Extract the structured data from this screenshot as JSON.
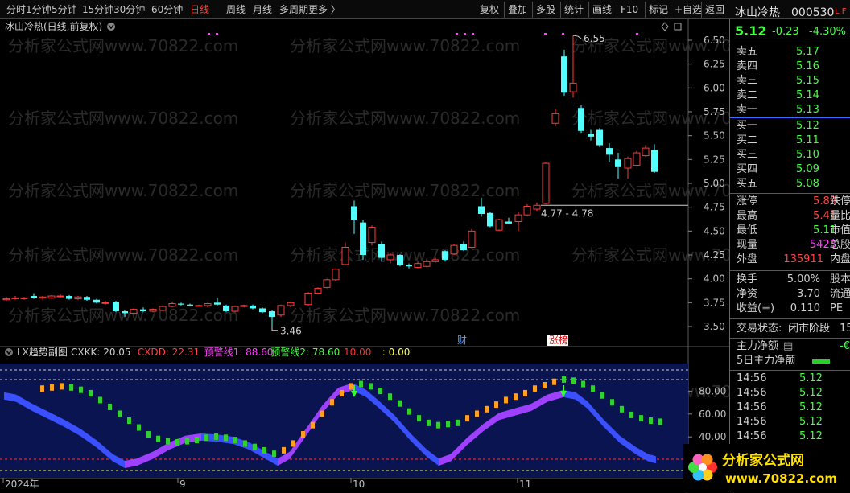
{
  "toolbar": {
    "left_items": [
      "分时",
      "1分钟",
      "5分钟",
      "15分钟",
      "30分钟",
      "60分钟",
      "日线",
      "周线",
      "月线",
      "多周期",
      "更多 〉"
    ],
    "active_item": "日线",
    "right_items": [
      "复权",
      "叠加",
      "多股",
      "统计",
      "画线",
      "F10",
      "标记",
      "+自选",
      "返回"
    ]
  },
  "main_chart": {
    "title": "冰山冷热(日线,前复权)",
    "y_ticks": [
      "6.50",
      "6.25",
      "6.00",
      "5.75",
      "5.50",
      "5.25",
      "5.00",
      "4.75",
      "4.50",
      "4.25",
      "4.00",
      "3.75",
      "3.50"
    ],
    "high_label": "6.55",
    "low_label": "3.46",
    "range_label": "4.77 - 4.78",
    "event_tags": [
      "财",
      "涨榜"
    ],
    "watermark": "分析家公式网www.70822.com"
  },
  "indicator": {
    "name": "LX趋势副图",
    "params": [
      {
        "text": "CXKK: 20.05",
        "color": "#d0d0d0"
      },
      {
        "text": "CXDD: 22.31",
        "color": "#ff4444"
      },
      {
        "text": "预警线1: 88.60",
        "color": "#ff44ff"
      },
      {
        "text": "预警线2: 78.60",
        "color": "#44ff44"
      },
      {
        "text": ": 10.00",
        "color": "#ff3333"
      },
      {
        "text": ": 0.00",
        "color": "#ffff44"
      }
    ],
    "y_ticks": [
      "80.00",
      "60.00",
      "40.00"
    ]
  },
  "x_axis": [
    "2024年",
    "9",
    "10",
    "11"
  ],
  "stock": {
    "name": "冰山冷热",
    "code": "000530",
    "flag": "L F",
    "price": "5.12",
    "change": "-0.23",
    "change_pct": "-4.30%"
  },
  "sell_levels": [
    {
      "label": "卖五",
      "price": "5.17"
    },
    {
      "label": "卖四",
      "price": "5.16"
    },
    {
      "label": "卖三",
      "price": "5.15"
    },
    {
      "label": "卖二",
      "price": "5.14"
    },
    {
      "label": "卖一",
      "price": "5.13"
    }
  ],
  "buy_levels": [
    {
      "label": "买一",
      "price": "5.12"
    },
    {
      "label": "买二",
      "price": "5.11"
    },
    {
      "label": "买三",
      "price": "5.10"
    },
    {
      "label": "买四",
      "price": "5.09"
    },
    {
      "label": "买五",
      "price": "5.08"
    }
  ],
  "quote_stats": [
    {
      "label": "涨停",
      "value": "5.89",
      "color": "#ff4444",
      "extra": "跌停"
    },
    {
      "label": "最高",
      "value": "5.41",
      "color": "#ff4444",
      "extra": "量比"
    },
    {
      "label": "最低",
      "value": "5.11",
      "color": "#44ff44",
      "extra": "市值"
    },
    {
      "label": "现量",
      "value": "5423",
      "color": "#ff44ff",
      "extra": "总股"
    },
    {
      "label": "外盘",
      "value": "135911",
      "color": "#ff4444",
      "extra": "内盘"
    }
  ],
  "fundamentals": [
    {
      "label": "换手",
      "value": "5.00%",
      "extra": "股本"
    },
    {
      "label": "净资",
      "value": "3.70",
      "extra": "流通"
    },
    {
      "label": "收益(≡)",
      "value": "0.110",
      "extra": "PE"
    }
  ],
  "trade_status": {
    "label": "交易状态:",
    "value": "闭市阶段",
    "extra": "15"
  },
  "fund_flow": [
    {
      "label": "主力净额",
      "value": "-€"
    },
    {
      "label": "5日主力净额",
      "value": ""
    }
  ],
  "ticks": [
    {
      "time": "14:56",
      "price": "5.12"
    },
    {
      "time": "14:56",
      "price": "5.12"
    },
    {
      "time": "14:56",
      "price": "5.12"
    },
    {
      "time": "14:56",
      "price": "5.12"
    },
    {
      "time": "14:56",
      "price": "5.12"
    }
  ],
  "logo": {
    "text": "分析家公式网",
    "url": "www.70822.com"
  },
  "colors": {
    "up": "#ff3b3b",
    "down": "#54ffff",
    "accent_blue": "#3a6cff",
    "warn_purple": "#a040ff"
  }
}
